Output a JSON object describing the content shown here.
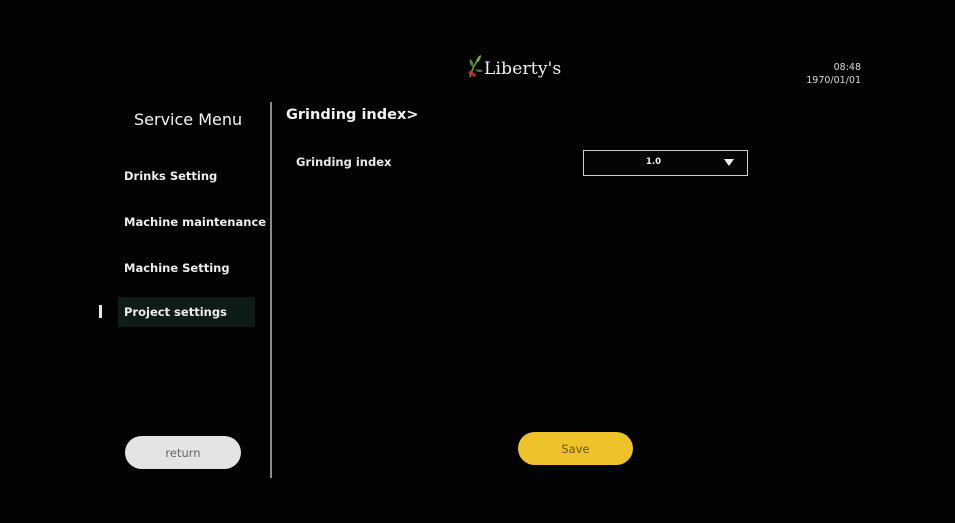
{
  "header": {
    "brand": "Liberty's",
    "time": "08:48",
    "date": "1970/01/01"
  },
  "sidebar": {
    "title": "Service Menu",
    "items": [
      {
        "label": "Drinks Setting",
        "active": false
      },
      {
        "label": "Machine maintenance",
        "active": false
      },
      {
        "label": "Machine Setting",
        "active": false
      },
      {
        "label": "Project settings",
        "active": true
      }
    ],
    "return_label": "return"
  },
  "main": {
    "breadcrumb": "Grinding index>",
    "field": {
      "label": "Grinding index",
      "value": "1.0"
    },
    "save_label": "Save"
  },
  "colors": {
    "background": "#000000",
    "save_button": "#eec22a",
    "return_button": "#e4e4e4",
    "active_item_bg": "#0e1b17"
  },
  "icons": {
    "logo": "coffee-branch-logo-icon",
    "dropdown": "triangle-down-icon"
  }
}
